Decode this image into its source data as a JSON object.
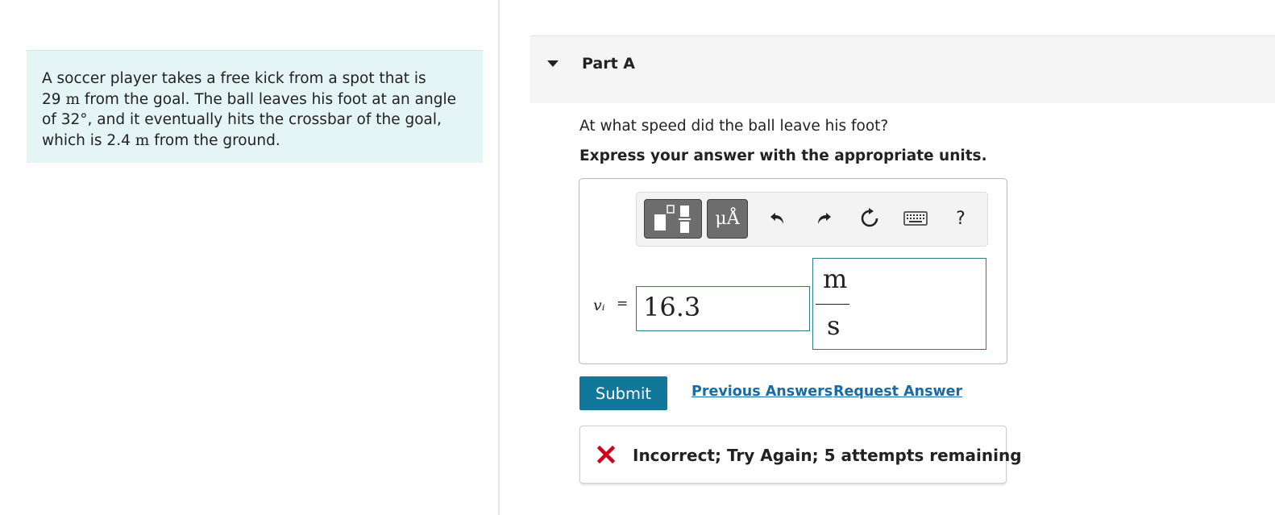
{
  "problem": {
    "line1": "A soccer player takes a free kick from a spot that is",
    "line2_num": "29",
    "line2_unit": "m",
    "line2_rest": "from the goal. The ball leaves his foot at an angle",
    "line3_pre": "of 32",
    "line3_deg": "°",
    "line3_rest": ", and it eventually hits the crossbar of the goal,",
    "line4_pre": "which is 2.4",
    "line4_unit": "m",
    "line4_rest": "from the ground."
  },
  "part": {
    "title": "Part A",
    "question": "At what speed did the ball leave his foot?",
    "instruction": "Express your answer with the appropriate units."
  },
  "toolbar": {
    "units_button_label": "μÅ",
    "icons": [
      "templates-icon",
      "units-icon",
      "undo-icon",
      "redo-icon",
      "reset-icon",
      "keyboard-icon",
      "help-icon"
    ],
    "help_label": "?"
  },
  "answer": {
    "variable": "vᵢ",
    "equals": "=",
    "value": "16.3",
    "unit_numerator": "m",
    "unit_denominator": "s"
  },
  "actions": {
    "submit_label": "Submit",
    "previous_answers_label": "Previous Answers",
    "request_answer_label": "Request Answer"
  },
  "feedback": {
    "message": "Incorrect; Try Again; 5 attempts remaining",
    "status_color": "#d0021b"
  },
  "colors": {
    "accent": "#11779b",
    "link": "#1b6aa1",
    "problem_background": "#e5f4f4"
  }
}
